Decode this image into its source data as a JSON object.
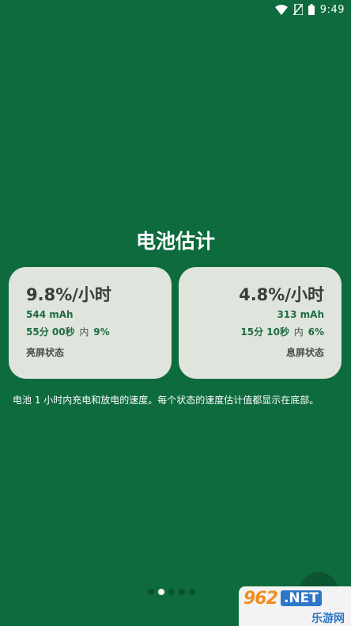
{
  "status_bar": {
    "time": "9:49",
    "icons": [
      "wifi-icon",
      "no-sim-icon",
      "battery-icon"
    ]
  },
  "title": "电池估计",
  "cards": [
    {
      "rate": "9.8%/小时",
      "mah": "544 mAh",
      "time": "55分 00秒",
      "in_label": "内",
      "percent": "9%",
      "state": "亮屏状态"
    },
    {
      "rate": "4.8%/小时",
      "mah": "313 mAh",
      "time": "15分 10秒",
      "in_label": "内",
      "percent": "6%",
      "state": "息屏状态"
    }
  ],
  "description": "电池 1 小时内充电和放电的速度。每个状态的速度估计值都显示在底部。",
  "pager": {
    "count": 5,
    "active_index": 1
  },
  "watermark": {
    "logo": "962",
    "net": ".NET",
    "site": "乐游网"
  },
  "colors": {
    "background": "#0d6b3e",
    "card": "#dfe5dd",
    "accent_text": "#1f6b43"
  }
}
